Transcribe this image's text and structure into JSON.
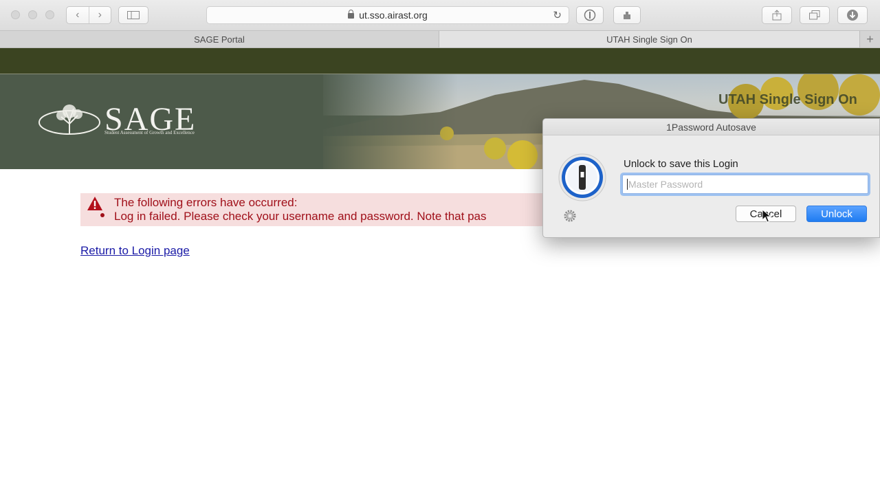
{
  "browser": {
    "url": "ut.sso.airast.org",
    "tabs": [
      {
        "label": "SAGE Portal",
        "active": false
      },
      {
        "label": "UTAH Single Sign On",
        "active": true
      }
    ],
    "icons": [
      "back-icon",
      "forward-icon",
      "sidebar-icon",
      "lock-icon",
      "reload-icon",
      "onepassword-toolbar-icon",
      "extension-icon",
      "share-icon",
      "tabs-overview-icon",
      "downloads-icon",
      "new-tab-icon"
    ]
  },
  "page": {
    "logo": {
      "word": "SAGE",
      "subtitle": "Student Assessment of Growth and Excellence"
    },
    "site_title": "UTAH Single Sign On",
    "error": {
      "title": "The following errors have occurred:",
      "items": [
        "Log in failed. Please check your username and password. Note that pas"
      ]
    },
    "return_link": "Return to Login page",
    "colors": {
      "header_bar": "#3b4421",
      "error_bg": "#f6dede",
      "error_text": "#a0101a",
      "link": "#1a1aa6"
    }
  },
  "dialog": {
    "title": "1Password Autosave",
    "message": "Unlock to save this Login",
    "password_placeholder": "Master Password",
    "password_value": "",
    "cancel_label": "Cancel",
    "unlock_label": "Unlock",
    "accent": "#1f7cf1"
  }
}
